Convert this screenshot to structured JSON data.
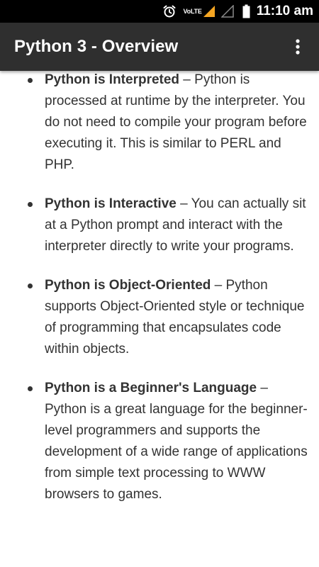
{
  "status_bar": {
    "network_label": "VoLTE",
    "time": "11:10 am",
    "signal_color": "#f5a623"
  },
  "app_bar": {
    "title": "Python 3 - Overview"
  },
  "points": [
    {
      "term": "Python is Interpreted",
      "description": " – Python is processed at runtime by the interpreter. You do not need to compile your program before executing it. This is similar to PERL and PHP."
    },
    {
      "term": "Python is Interactive",
      "description": " – You can actually sit at a Python prompt and interact with the interpreter directly to write your programs."
    },
    {
      "term": "Python is Object-Oriented",
      "description": " – Python supports Object-Oriented style or technique of programming that encapsulates code within objects."
    },
    {
      "term": "Python is a Beginner's Language",
      "description": " – Python is a great language for the beginner-level programmers and supports the development of a wide range of applications from simple text processing to WWW browsers to games."
    }
  ]
}
